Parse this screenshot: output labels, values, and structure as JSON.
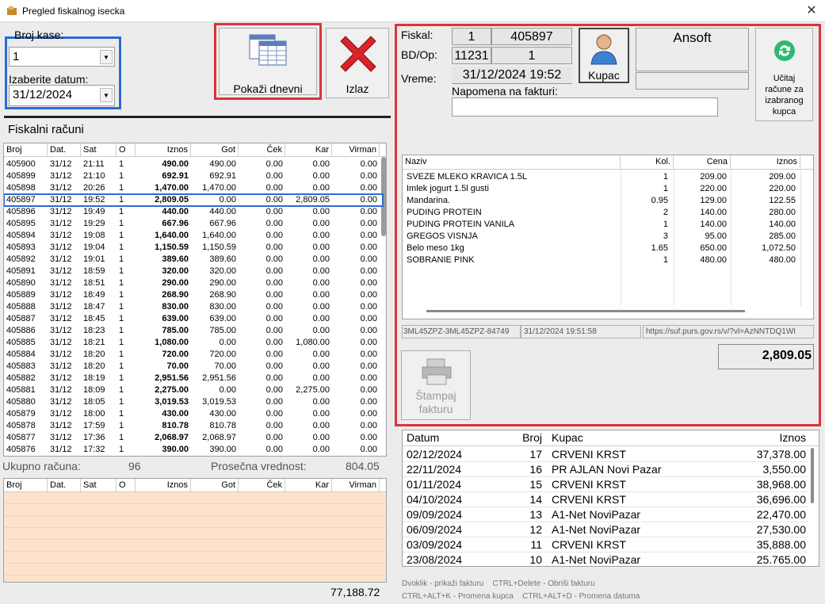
{
  "window": {
    "title": "Pregled fiskalnog isecka",
    "close_symbol": "✕"
  },
  "filters": {
    "register_label": "Broj kase:",
    "register_value": "1",
    "date_label": "Izaberite datum:",
    "date_value": "31/12/2024"
  },
  "buttons": {
    "show_daily": "Pokaži dnevni",
    "exit": "Izlaz",
    "customer": "Kupac",
    "load_invoices": "Učitaj račune za izabranog kupca",
    "print_invoice": "Štampaj fakturu"
  },
  "receipts": {
    "section_title": "Fiskalni računi",
    "columns": [
      "Broj",
      "Dat.",
      "Sat",
      "O",
      "Iznos",
      "Got",
      "Ček",
      "Kar",
      "Virman"
    ],
    "rows": [
      [
        "405900",
        "31/12",
        "21:11",
        "1",
        "490.00",
        "490.00",
        "0.00",
        "0.00",
        "0.00"
      ],
      [
        "405899",
        "31/12",
        "21:10",
        "1",
        "692.91",
        "692.91",
        "0.00",
        "0.00",
        "0.00"
      ],
      [
        "405898",
        "31/12",
        "20:26",
        "1",
        "1,470.00",
        "1,470.00",
        "0.00",
        "0.00",
        "0.00"
      ],
      [
        "405897",
        "31/12",
        "19:52",
        "1",
        "2,809.05",
        "0.00",
        "0.00",
        "2,809.05",
        "0.00"
      ],
      [
        "405896",
        "31/12",
        "19:49",
        "1",
        "440.00",
        "440.00",
        "0.00",
        "0.00",
        "0.00"
      ],
      [
        "405895",
        "31/12",
        "19:29",
        "1",
        "667.96",
        "667.96",
        "0.00",
        "0.00",
        "0.00"
      ],
      [
        "405894",
        "31/12",
        "19:08",
        "1",
        "1,640.00",
        "1,640.00",
        "0.00",
        "0.00",
        "0.00"
      ],
      [
        "405893",
        "31/12",
        "19:04",
        "1",
        "1,150.59",
        "1,150.59",
        "0.00",
        "0.00",
        "0.00"
      ],
      [
        "405892",
        "31/12",
        "19:01",
        "1",
        "389.60",
        "389.60",
        "0.00",
        "0.00",
        "0.00"
      ],
      [
        "405891",
        "31/12",
        "18:59",
        "1",
        "320.00",
        "320.00",
        "0.00",
        "0.00",
        "0.00"
      ],
      [
        "405890",
        "31/12",
        "18:51",
        "1",
        "290.00",
        "290.00",
        "0.00",
        "0.00",
        "0.00"
      ],
      [
        "405889",
        "31/12",
        "18:49",
        "1",
        "268.90",
        "268.90",
        "0.00",
        "0.00",
        "0.00"
      ],
      [
        "405888",
        "31/12",
        "18:47",
        "1",
        "830.00",
        "830.00",
        "0.00",
        "0.00",
        "0.00"
      ],
      [
        "405887",
        "31/12",
        "18:45",
        "1",
        "639.00",
        "639.00",
        "0.00",
        "0.00",
        "0.00"
      ],
      [
        "405886",
        "31/12",
        "18:23",
        "1",
        "785.00",
        "785.00",
        "0.00",
        "0.00",
        "0.00"
      ],
      [
        "405885",
        "31/12",
        "18:21",
        "1",
        "1,080.00",
        "0.00",
        "0.00",
        "1,080.00",
        "0.00"
      ],
      [
        "405884",
        "31/12",
        "18:20",
        "1",
        "720.00",
        "720.00",
        "0.00",
        "0.00",
        "0.00"
      ],
      [
        "405883",
        "31/12",
        "18:20",
        "1",
        "70.00",
        "70.00",
        "0.00",
        "0.00",
        "0.00"
      ],
      [
        "405882",
        "31/12",
        "18:19",
        "1",
        "2,951.56",
        "2,951.56",
        "0.00",
        "0.00",
        "0.00"
      ],
      [
        "405881",
        "31/12",
        "18:09",
        "1",
        "2,275.00",
        "0.00",
        "0.00",
        "2,275.00",
        "0.00"
      ],
      [
        "405880",
        "31/12",
        "18:05",
        "1",
        "3,019.53",
        "3,019.53",
        "0.00",
        "0.00",
        "0.00"
      ],
      [
        "405879",
        "31/12",
        "18:00",
        "1",
        "430.00",
        "430.00",
        "0.00",
        "0.00",
        "0.00"
      ],
      [
        "405878",
        "31/12",
        "17:59",
        "1",
        "810.78",
        "810.78",
        "0.00",
        "0.00",
        "0.00"
      ],
      [
        "405877",
        "31/12",
        "17:36",
        "1",
        "2,068.97",
        "2,068.97",
        "0.00",
        "0.00",
        "0.00"
      ],
      [
        "405876",
        "31/12",
        "17:32",
        "1",
        "390.00",
        "390.00",
        "0.00",
        "0.00",
        "0.00"
      ]
    ],
    "selected_index": 3,
    "total_count_label": "Ukupno računa:",
    "total_count": "96",
    "average_label": "Prosečna vrednost:",
    "average_value": "804.05",
    "grand_total": "77,188.72"
  },
  "detail": {
    "fiscal_label": "Fiskal:",
    "fiscal_a": "1",
    "fiscal_b": "405897",
    "bdop_label": "BD/Op:",
    "bdop_a": "11231",
    "bdop_b": "1",
    "time_label": "Vreme:",
    "time_value": "31/12/2024 19:52",
    "note_label": "Napomena na fakturi:",
    "note_value": "",
    "customer_name": "Ansoft",
    "customer_extra": "",
    "item_columns": [
      "Naziv",
      "Kol.",
      "Cena",
      "Iznos"
    ],
    "items": [
      [
        "SVEZE MLEKO KRAVICA 1.5L",
        "1",
        "209.00",
        "209.00"
      ],
      [
        "Imlek jogurt 1.5l gusti",
        "1",
        "220.00",
        "220.00"
      ],
      [
        "Mandarina.",
        "0.95",
        "129.00",
        "122.55"
      ],
      [
        "PUDING PROTEIN",
        "2",
        "140.00",
        "280.00"
      ],
      [
        "PUDING PROTEIN VANILA",
        "1",
        "140.00",
        "140.00"
      ],
      [
        "GREGOS VISNJA",
        "3",
        "95.00",
        "285.00"
      ],
      [
        "Belo meso 1kg",
        "1.65",
        "650.00",
        "1,072.50"
      ],
      [
        "SOBRANIE PINK",
        "1",
        "480.00",
        "480.00"
      ]
    ],
    "sig_code": "3ML45ZPZ-3ML45ZPZ-84749",
    "sig_time": "31/12/2024 19:51:58",
    "sig_url": "https://suf.purs.gov.rs/v/?vl=AzNNTDQ1WI",
    "total": "2,809.05"
  },
  "history": {
    "columns": [
      "Datum",
      "Broj",
      "Kupac",
      "Iznos"
    ],
    "rows": [
      [
        "02/12/2024",
        "17",
        "CRVENI KRST",
        "37,378.00"
      ],
      [
        "22/11/2024",
        "16",
        "PR AJLAN Novi Pazar",
        "3,550.00"
      ],
      [
        "01/11/2024",
        "15",
        "CRVENI KRST",
        "38,968.00"
      ],
      [
        "04/10/2024",
        "14",
        "CRVENI KRST",
        "36,696.00"
      ],
      [
        "09/09/2024",
        "13",
        "A1-Net NoviPazar",
        "22,470.00"
      ],
      [
        "06/09/2024",
        "12",
        "A1-Net NoviPazar",
        "27,530.00"
      ],
      [
        "03/09/2024",
        "11",
        "CRVENI KRST",
        "35,888.00"
      ],
      [
        "23/08/2024",
        "10",
        "A1-Net NoviPazar",
        "25.765.00"
      ]
    ]
  },
  "hints": {
    "line1": "Dvoklik - prikaži fakturu    CTRL+Delete - Obriši fakturu",
    "line2": "CTRL+ALT+K - Promena kupca    CTRL+ALT+D - Promena datuma"
  },
  "colors": {
    "highlight_red": "#d9343b",
    "highlight_blue": "#2a6bd6",
    "peach": "#fde3cc",
    "exit_red": "#d8232a"
  },
  "icons": [
    "app-icon",
    "close-icon",
    "grid-report-icon",
    "red-x-icon",
    "customer-person-icon",
    "refresh-icon",
    "printer-icon"
  ]
}
